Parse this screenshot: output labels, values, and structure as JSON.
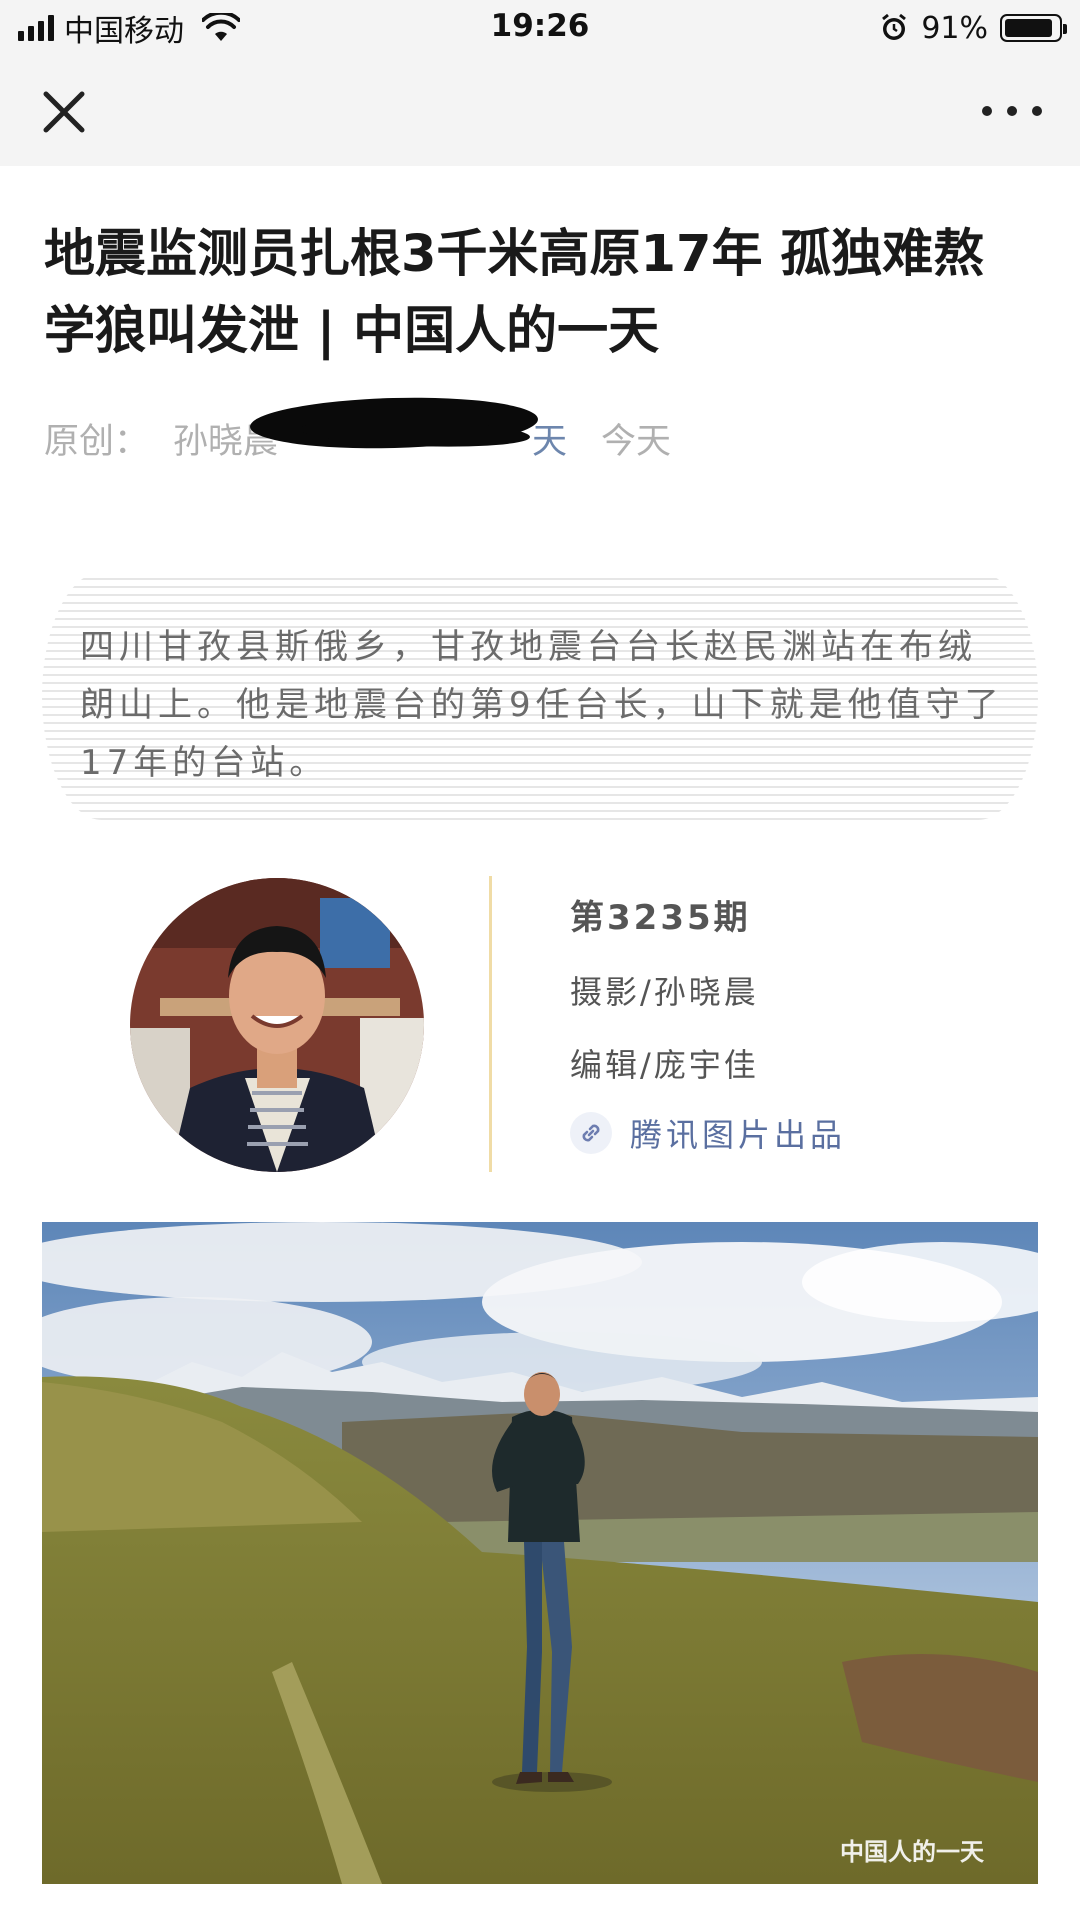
{
  "status_bar": {
    "carrier": "中国移动",
    "time": "19:26",
    "battery_percent": "91%",
    "battery_level": 0.91
  },
  "nav": {
    "close_icon": "close-icon",
    "more_icon": "more-dots-icon"
  },
  "article": {
    "title": "地震监测员扎根3千米高原17年 孤独难熬学狼叫发泄 | 中国人的一天",
    "meta_original": "原创：",
    "meta_author": "孙晓晨",
    "meta_account_visible_tail": "天",
    "meta_date": "今天",
    "lead": "四川甘孜县斯俄乡，甘孜地震台台长赵民渊站在布绒朗山上。他是地震台的第9任台长，山下就是他值守了17年的台站。",
    "issue": "第3235期",
    "photo_credit": "摄影/孙晓晨",
    "editor_credit": "编辑/庞宇佳",
    "producer": "腾讯图片出品",
    "watermark": "中国人的一天"
  },
  "colors": {
    "accent_link": "#6d86ad",
    "divider": "#f0dca6"
  }
}
